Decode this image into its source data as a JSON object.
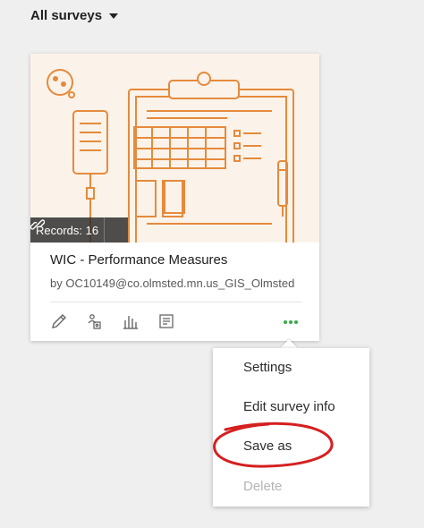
{
  "filter": {
    "label": "All surveys"
  },
  "card": {
    "records_label": "Records: 16",
    "title": "WIC - Performance Measures",
    "owner": "by OC10149@co.olmsted.mn.us_GIS_Olmsted",
    "accent": "#e58a3c"
  },
  "toolbar": {
    "icons": [
      "edit-icon",
      "collaborate-icon",
      "analyze-icon",
      "data-icon",
      "more-icon"
    ],
    "more_color": "#35ac46"
  },
  "menu": {
    "items": [
      "Settings",
      "Edit survey info",
      "Save as",
      "Delete"
    ],
    "disabled": [
      "Delete"
    ]
  },
  "annotation": {
    "color": "#d61f1f",
    "target": "Save as"
  }
}
